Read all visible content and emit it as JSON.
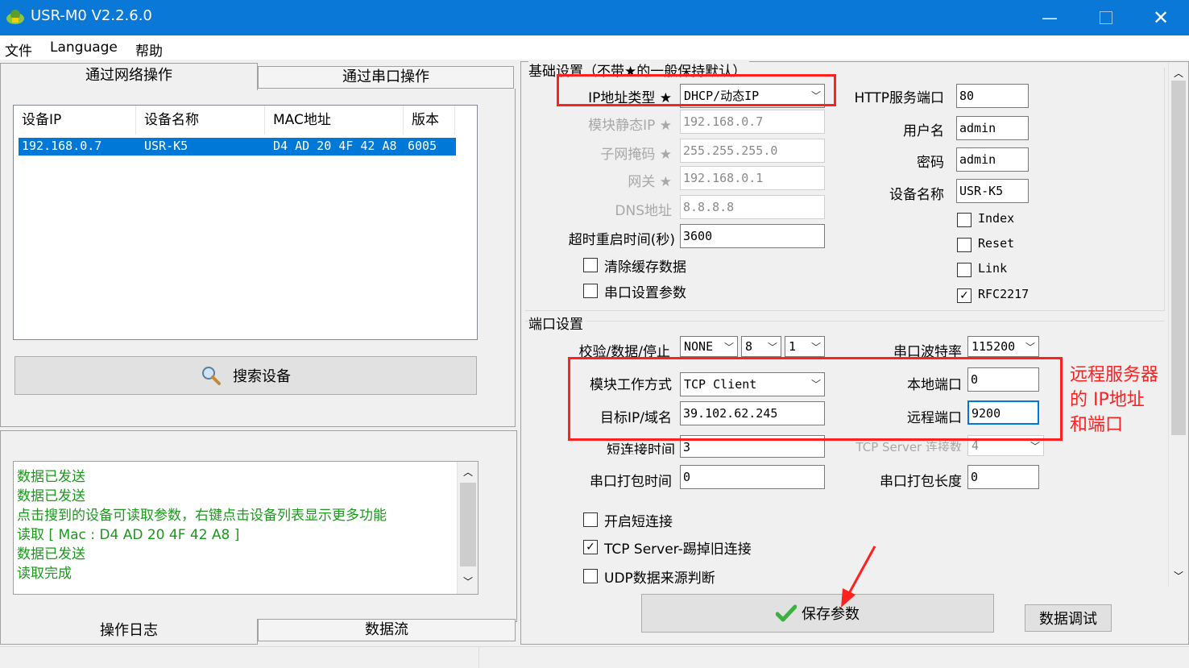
{
  "window": {
    "title": "USR-M0 V2.2.6.0"
  },
  "menu": [
    "文件",
    "Language",
    "帮助"
  ],
  "left": {
    "tabs": [
      "通过网络操作",
      "通过串口操作"
    ],
    "columns": [
      "设备IP",
      "设备名称",
      "MAC地址",
      "版本"
    ],
    "row": {
      "ip": "192.168.0.7",
      "name": "USR-K5",
      "mac": "D4 AD 20 4F 42 A8",
      "ver": "6005"
    },
    "search_button": "搜索设备",
    "log": [
      "数据已发送",
      "数据已发送",
      "点击搜到的设备可读取参数，右键点击设备列表显示更多功能",
      "读取 [ Mac : D4 AD 20 4F 42 A8 ]",
      "数据已发送",
      "读取完成"
    ],
    "bottom_tabs": [
      "操作日志",
      "数据流"
    ]
  },
  "basic": {
    "group_title": "基础设置（不带★的一般保持默认）",
    "ip_type_label": "IP地址类型 ★",
    "ip_type_value": "DHCP/动态IP",
    "static_ip_label": "模块静态IP ★",
    "static_ip_value": "192.168.0.7",
    "mask_label": "子网掩码 ★",
    "mask_value": "255.255.255.0",
    "gateway_label": "网关 ★",
    "gateway_value": "192.168.0.1",
    "dns_label": "DNS地址",
    "dns_value": "8.8.8.8",
    "timeout_label": "超时重启时间(秒)",
    "timeout_value": "3600",
    "clear_cache_label": "清除缓存数据",
    "serial_param_label": "串口设置参数",
    "http_port_label": "HTTP服务端口",
    "http_port_value": "80",
    "user_label": "用户名",
    "user_value": "admin",
    "pwd_label": "密码",
    "pwd_value": "admin",
    "devname_label": "设备名称",
    "devname_value": "USR-K5",
    "index_label": "Index",
    "reset_label": "Reset",
    "link_label": "Link",
    "rfc_label": "RFC2217",
    "rfc_check": "✓"
  },
  "port": {
    "group_title": "端口设置",
    "parity_label": "校验/数据/停止",
    "parity_value": "NONE",
    "data_value": "8",
    "stop_value": "1",
    "baud_label": "串口波特率",
    "baud_value": "115200",
    "mode_label": "模块工作方式",
    "mode_value": "TCP Client",
    "local_port_label": "本地端口",
    "local_port_value": "0",
    "target_label": "目标IP/域名",
    "target_value": "39.102.62.245",
    "remote_port_label": "远程端口",
    "remote_port_value": "9200",
    "short_time_label": "短连接时间",
    "short_time_value": "3",
    "server_conn_label": "TCP Server 连接数",
    "server_conn_value": "4",
    "pack_time_label": "串口打包时间",
    "pack_time_value": "0",
    "pack_len_label": "串口打包长度",
    "pack_len_value": "0",
    "short_conn_label": "开启短连接",
    "kick_label": "TCP Server-踢掉旧连接",
    "kick_check": "✓",
    "udp_label": "UDP数据来源判断"
  },
  "actions": {
    "save": "保存参数",
    "debug": "数据调试"
  },
  "annotation": [
    "远程服务器",
    "的 IP地址",
    "和端口"
  ],
  "colors": {
    "titlebar": "#0a78d7",
    "selection": "#0078d7",
    "log_text": "#1a9a1a",
    "annotation": "#ff2020"
  }
}
